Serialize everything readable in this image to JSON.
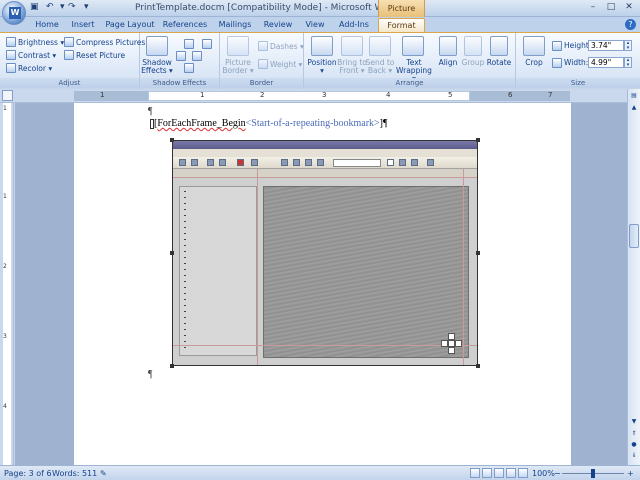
{
  "app": {
    "title": "PrintTemplate.docm [Compatibility Mode] - Microsoft Word",
    "context_tab_group": "Picture Tools"
  },
  "quick_access": [
    "save-icon",
    "undo-icon",
    "redo-icon",
    "customize-icon"
  ],
  "window_controls": {
    "minimize": "–",
    "maximize": "□",
    "close": "✕"
  },
  "tabs": [
    {
      "label": "Home"
    },
    {
      "label": "Insert"
    },
    {
      "label": "Page Layout"
    },
    {
      "label": "References"
    },
    {
      "label": "Mailings"
    },
    {
      "label": "Review"
    },
    {
      "label": "View"
    },
    {
      "label": "Add-Ins"
    },
    {
      "label": "Format",
      "active": true
    }
  ],
  "ribbon": {
    "adjust": {
      "label": "Adjust",
      "brightness": "Brightness ▾",
      "contrast": "Contrast ▾",
      "recolor": "Recolor ▾",
      "compress": "Compress Pictures",
      "reset": "Reset Picture"
    },
    "shadow": {
      "label": "Shadow Effects",
      "shadow_line1": "Shadow",
      "shadow_line2": "Effects ▾"
    },
    "border": {
      "label": "Border",
      "picture_border_line1": "Picture",
      "picture_border_line2": "Border ▾",
      "dashes": "Dashes ▾",
      "weight": "Weight ▾"
    },
    "arrange": {
      "label": "Arrange",
      "position_line1": "Position",
      "position_line2": "▾",
      "bring_front_line1": "Bring to",
      "bring_front_line2": "Front ▾",
      "send_back_line1": "Send to",
      "send_back_line2": "Back ▾",
      "text_wrapping_line1": "Text",
      "text_wrapping_line2": "Wrapping ▾",
      "align": "Align",
      "group": "Group",
      "rotate": "Rotate"
    },
    "size": {
      "label": "Size",
      "crop": "Crop",
      "height_label": "Height:",
      "height_value": "3.74\"",
      "width_label": "Width:",
      "width_value": "4.99\""
    }
  },
  "ruler": {
    "h_numbers": [
      "1",
      "1",
      "2",
      "3",
      "4",
      "5",
      "6",
      "7"
    ],
    "v_numbers": [
      "1",
      "1",
      "2",
      "3",
      "4"
    ]
  },
  "document": {
    "pilcrow": "¶",
    "field_name": "ForEachFrame_Begin",
    "field_hint": "<Start-of-a-repeating-bookmark>"
  },
  "status": {
    "page": "Page: 3 of 6",
    "words": "Words: 511",
    "zoom": "100%",
    "zoom_minus": "−",
    "zoom_plus": "+"
  }
}
